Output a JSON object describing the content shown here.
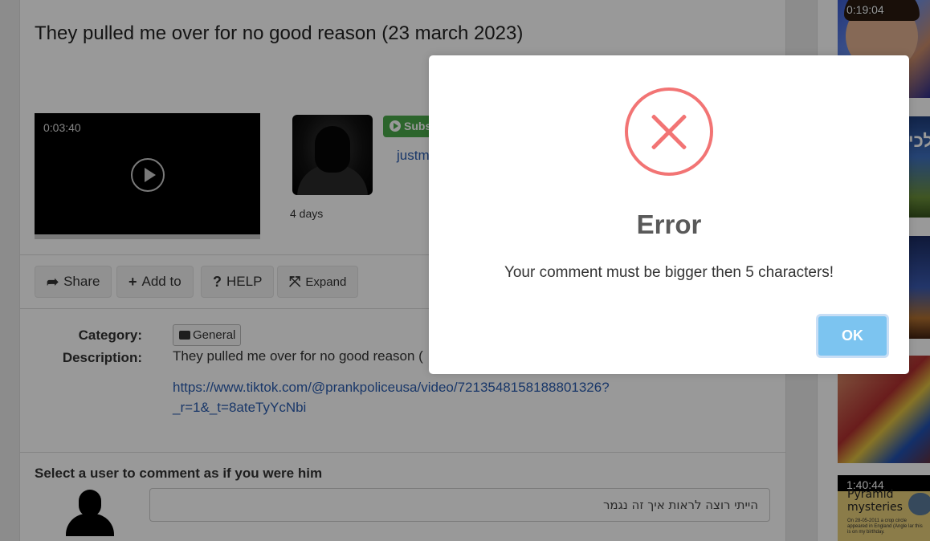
{
  "video": {
    "title": "They pulled me over for no good reason (23 march 2023)",
    "duration": "0:03:40",
    "upload_age": "4 days"
  },
  "channel": {
    "subscribe_label": "Subs",
    "name": "justm"
  },
  "toolbar": {
    "share_label": "Share",
    "add_label": "Add to",
    "help_label": "HELP",
    "expand_label": "Expand"
  },
  "details": {
    "category_label": "Category:",
    "category_value": "General",
    "description_label": "Description:",
    "description_text": "They pulled me over for no good reason (",
    "description_link": "https://www.tiktok.com/@prankpoliceusa/video/7213548158188801326?_r=1&_t=8ateTyYcNbi"
  },
  "comments": {
    "heading": "Select a user to comment as if you were him",
    "input_value": "הייתי רוצה לראות איך זה נגמר"
  },
  "sidebar": {
    "thumb1_time": "0:19:04",
    "thumb2_text": "לכי",
    "thumb5_time": "1:40:44",
    "thumb5_title": "Pyramid mysteries",
    "thumb5_small": "On 28-05-2011 a crop circle appeared in England (Angle lar this is on my birthday."
  },
  "modal": {
    "title": "Error",
    "message": "Your comment must be bigger then 5 characters!",
    "ok_label": "OK",
    "icon": "error-x-icon",
    "accent_color": "#f27474",
    "button_color": "#7cc4f0"
  }
}
